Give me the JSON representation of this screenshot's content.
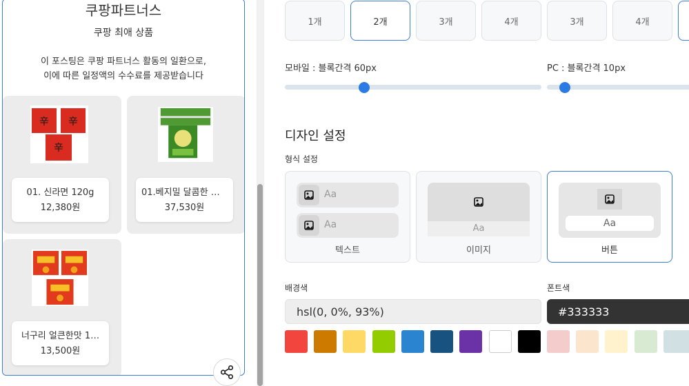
{
  "preview": {
    "title": "쿠팡파트너스",
    "subtitle": "쿠팡 최애 상품",
    "notice_line1": "이 포스팅은 쿠팡 파트너스 활동의 일환으로,",
    "notice_line2": "이에 따른 일정액의 수수료를 제공받습니다",
    "products": [
      {
        "name": "01. 신라면 120g",
        "price": "12,380원",
        "thumb_icon": "ramen-pack-image"
      },
      {
        "name": "01.베지밀 달콤한 비 …",
        "price": "37,530원",
        "thumb_icon": "soymilk-box-image"
      },
      {
        "name": "너구리 얼큰한맛 1…",
        "price": "13,500원",
        "thumb_icon": "ramen-pack-image"
      }
    ],
    "share_icon": "share-icon"
  },
  "settings": {
    "count_buttons": [
      "1개",
      "2개",
      "3개",
      "4개",
      "3개",
      "4개"
    ],
    "active_count_index": 1,
    "mobile_gap_label": "모바일 : 블록간격 60px",
    "pc_gap_label": "PC : 블록간격 10px",
    "mobile_gap_value": 60,
    "pc_gap_value": 10,
    "design_title": "디자인 설정",
    "format_label": "형식 설정",
    "formats": [
      {
        "label": "텍스트",
        "sample": "Aa"
      },
      {
        "label": "이미지",
        "sample": "Aa"
      },
      {
        "label": "버튼",
        "sample": "Aa"
      }
    ],
    "active_format_index": 2,
    "bg_color_label": "배경색",
    "font_color_label": "폰트색",
    "bg_color_value": "hsl(0, 0%, 93%)",
    "font_color_value": "#333333",
    "palette": [
      "#f2453d",
      "#cc7a00",
      "#ffd966",
      "#93cc00",
      "#2a84d0",
      "#185280",
      "#6b31a6",
      "#ffffff",
      "#000000",
      "#f4cccc",
      "#fce5cd",
      "#fff2cc",
      "#d9ead3",
      "#d0e0e3"
    ],
    "accent_color": "#3b7ddd"
  }
}
